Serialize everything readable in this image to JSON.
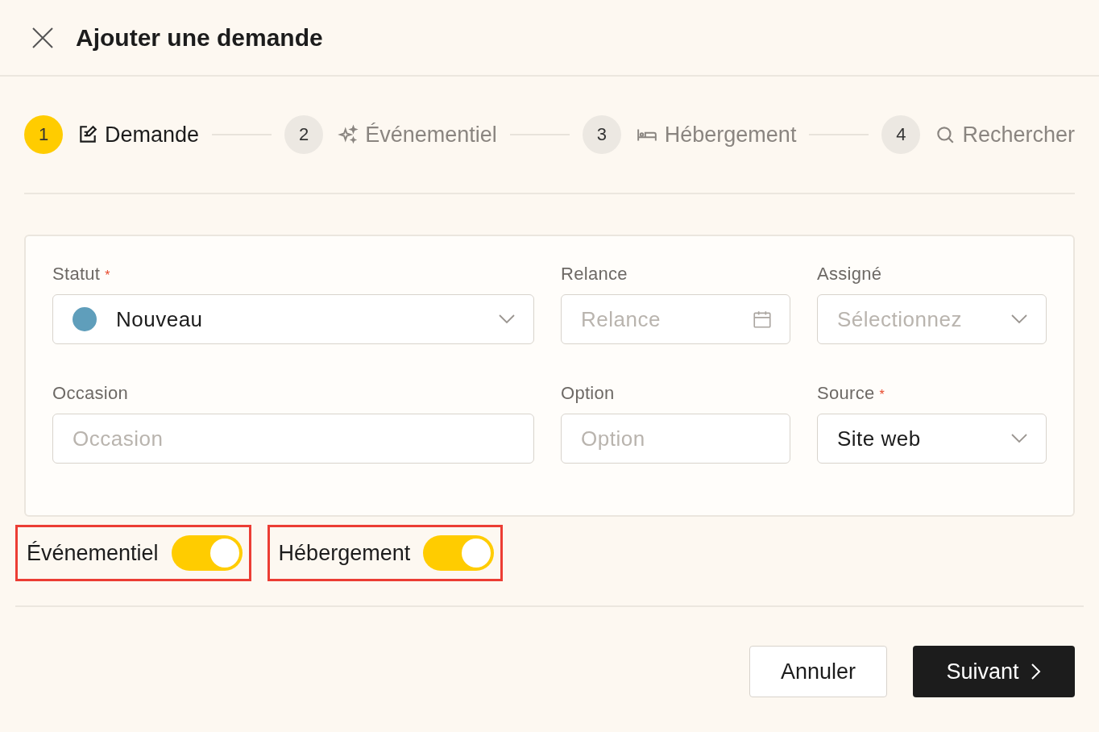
{
  "header": {
    "title": "Ajouter une demande"
  },
  "steps": [
    {
      "number": "1",
      "label": "Demande",
      "selected": true
    },
    {
      "number": "2",
      "label": "Événementiel",
      "selected": false
    },
    {
      "number": "3",
      "label": "Hébergement",
      "selected": false
    },
    {
      "number": "4",
      "label": "Rechercher",
      "selected": false
    }
  ],
  "form": {
    "fields": [
      {
        "kind": "status-select",
        "label": "Statut",
        "required_mark": "*",
        "value": "Nouveau",
        "color": "#5f9ebb"
      },
      {
        "kind": "date",
        "label": "Relance",
        "placeholder": "Relance"
      },
      {
        "kind": "select",
        "label": "Assigné",
        "placeholder": "Sélectionnez"
      },
      {
        "kind": "text",
        "label": "Occasion",
        "placeholder": "Occasion"
      },
      {
        "kind": "text",
        "label": "Option",
        "placeholder": "Option"
      },
      {
        "kind": "select",
        "label": "Source",
        "required_mark": "*",
        "value": "Site web"
      }
    ]
  },
  "toggles": [
    {
      "label": "Événementiel",
      "on": true,
      "highlighted": true
    },
    {
      "label": "Hébergement",
      "on": true,
      "highlighted": true
    }
  ],
  "buttons": [
    {
      "kind": "secondary",
      "label": "Annuler"
    },
    {
      "kind": "primary",
      "label": "Suivant"
    }
  ]
}
